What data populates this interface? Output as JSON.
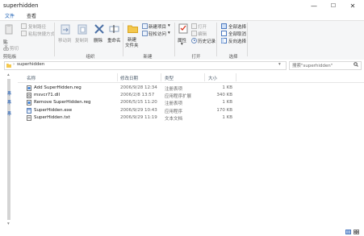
{
  "window": {
    "title": "superhidden",
    "minimize": "—",
    "maximize": "☐",
    "close": "✕"
  },
  "tabs": [
    {
      "label": "文件",
      "active": true
    },
    {
      "label": "查看",
      "active": false
    }
  ],
  "ribbon": {
    "clipboard": {
      "pin_label": "贴",
      "copy_path": "复制路径",
      "paste_shortcut": "粘贴快捷方式",
      "cut": "剪切",
      "group_label": "剪贴板"
    },
    "organize": {
      "move_to": "移动到",
      "copy_to": "复制到",
      "delete": "删除",
      "rename": "重命名",
      "group_label": "组织"
    },
    "new": {
      "new_folder": "新建",
      "new_folder_line2": "文件夹",
      "new_item": "新建项目",
      "easy_access": "轻松访问",
      "group_label": "新建"
    },
    "open": {
      "properties": "属性",
      "open": "打开",
      "edit": "编辑",
      "history": "历史记录",
      "group_label": "打开"
    },
    "select": {
      "select_all": "全部选择",
      "select_none": "全部取消",
      "invert": "反向选择",
      "group_label": "选择"
    }
  },
  "address": {
    "path": "superhidden",
    "search_placeholder": "搜索\"superhidden\""
  },
  "columns": {
    "name": "名称",
    "modified": "修改日期",
    "type": "类型",
    "size": "大小"
  },
  "files": [
    {
      "name": "Add SuperHidden.reg",
      "modified": "2006/9/28 12:34",
      "type": "注册表项",
      "size": "1 KB",
      "icon": "reg-file-icon"
    },
    {
      "name": "msvcr71.dll",
      "modified": "2006/2/8 13:57",
      "type": "应用程序扩展",
      "size": "340 KB",
      "icon": "dll-file-icon"
    },
    {
      "name": "Remove SuperHidden.reg",
      "modified": "2006/5/15 11:20",
      "type": "注册表项",
      "size": "1 KB",
      "icon": "reg-file-icon"
    },
    {
      "name": "SuperHidden.exe",
      "modified": "2006/9/29 10:43",
      "type": "应用程序",
      "size": "170 KB",
      "icon": "exe-file-icon"
    },
    {
      "name": "SuperHidden.txt",
      "modified": "2006/9/29 11:19",
      "type": "文本文档",
      "size": "1 KB",
      "icon": "txt-file-icon"
    }
  ]
}
